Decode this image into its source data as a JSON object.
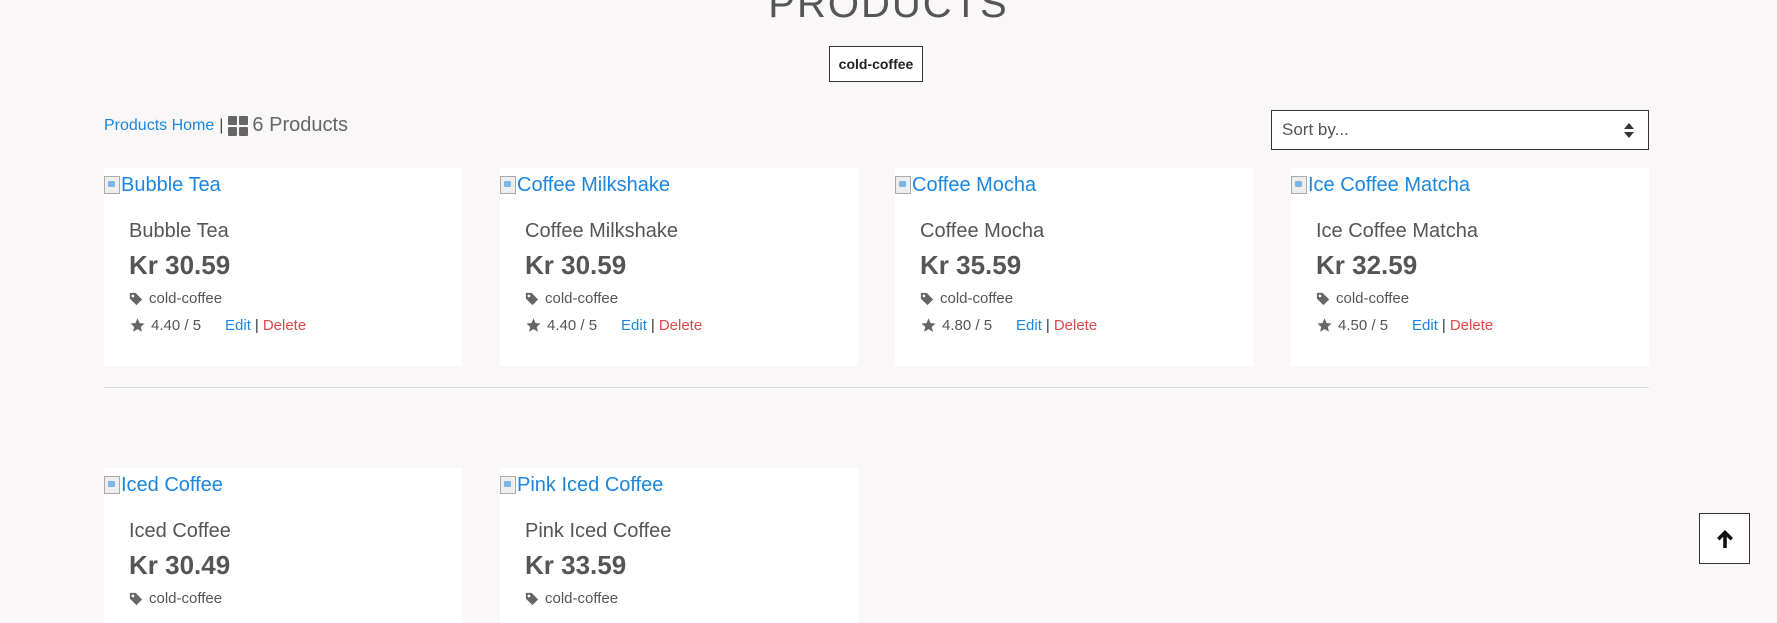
{
  "header": {
    "title": "PRODUCTS",
    "active_filter": "cold-coffee"
  },
  "toolbar": {
    "breadcrumb_home": "Products Home",
    "separator": "|",
    "product_count": "6 Products",
    "sort_placeholder": "Sort by..."
  },
  "products": [
    {
      "name": "Bubble Tea",
      "image_alt": "Bubble Tea",
      "price": "Kr 30.59",
      "category": "cold-coffee",
      "rating": "4.40 / 5",
      "edit_label": "Edit",
      "delete_label": "Delete"
    },
    {
      "name": "Coffee Milkshake",
      "image_alt": "Coffee Milkshake",
      "price": "Kr 30.59",
      "category": "cold-coffee",
      "rating": "4.40 / 5",
      "edit_label": "Edit",
      "delete_label": "Delete"
    },
    {
      "name": "Coffee Mocha",
      "image_alt": "Coffee Mocha",
      "price": "Kr 35.59",
      "category": "cold-coffee",
      "rating": "4.80 / 5",
      "edit_label": "Edit",
      "delete_label": "Delete"
    },
    {
      "name": "Ice Coffee Matcha",
      "image_alt": "Ice Coffee Matcha",
      "price": "Kr 32.59",
      "category": "cold-coffee",
      "rating": "4.50 / 5",
      "edit_label": "Edit",
      "delete_label": "Delete"
    },
    {
      "name": "Iced Coffee",
      "image_alt": "Iced Coffee",
      "price": "Kr 30.49",
      "category": "cold-coffee"
    },
    {
      "name": "Pink Iced Coffee",
      "image_alt": "Pink Iced Coffee",
      "price": "Kr 33.59",
      "category": "cold-coffee"
    }
  ],
  "colors": {
    "link": "#1a86e0",
    "danger": "#e04848",
    "background": "#f9f7f8"
  },
  "icons": {
    "view": "grid-icon",
    "category": "tag-icon",
    "rating": "star-icon",
    "back_to_top": "arrow-up-icon"
  }
}
